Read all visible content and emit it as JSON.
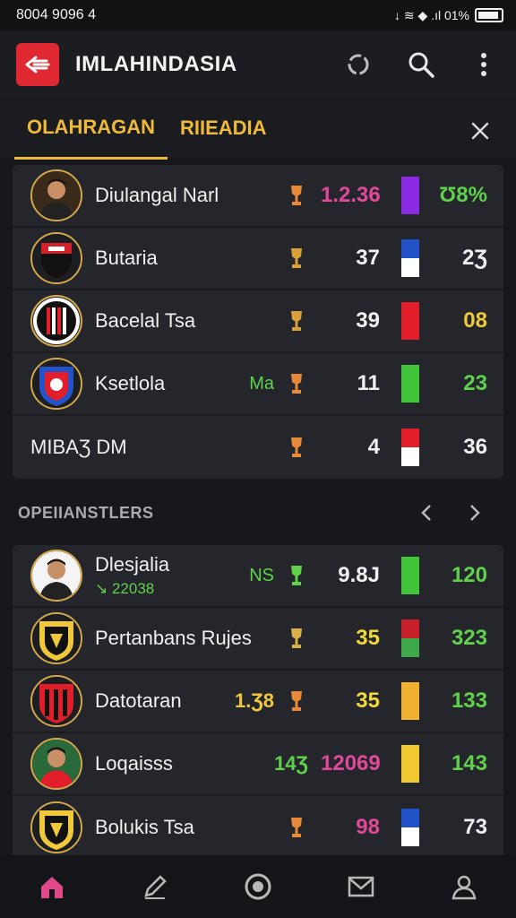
{
  "status": {
    "time": "8004 9096 4",
    "right": "↓ ≋ ◆ .ıl 01%"
  },
  "app": {
    "title": "IMLAHINDASIA"
  },
  "tabs": [
    {
      "label": "OLAHRAGAN"
    },
    {
      "label": "RIIEADIA"
    }
  ],
  "panel1": [
    {
      "name": "Diulangal Narl",
      "val1": "1.2.36",
      "val1_color": "#e0489a",
      "bar_top": "#8a2be2",
      "bar_bottom": "#8a2be2",
      "val2": "Ʊ8%",
      "val2_color": "#5fd14a",
      "crest": "player",
      "trophy_color": "#e8893a"
    },
    {
      "name": "Butaria",
      "val1": "37",
      "val1_color": "#f0f0f0",
      "bar_top": "#2352c8",
      "bar_bottom": "#ffffff",
      "val2": "2Ʒ",
      "val2_color": "#f0f0f0",
      "crest": "shield-red-black",
      "trophy_color": "#d9a03a"
    },
    {
      "name": "Bacelal Tsa",
      "val1": "39",
      "val1_color": "#f0f0f0",
      "bar_top": "#e21e2a",
      "bar_bottom": "#e21e2a",
      "val2": "08",
      "val2_color": "#f0c83a",
      "crest": "stripes-red-white",
      "trophy_color": "#d9a03a"
    },
    {
      "name": "Ksetlola",
      "tag": "Ma",
      "val1": "11",
      "val1_color": "#f0f0f0",
      "bar_top": "#3fc43a",
      "bar_bottom": "#3fc43a",
      "val2": "23",
      "val2_color": "#5fd14a",
      "crest": "shield-blue-red",
      "trophy_color": "#e8893a"
    },
    {
      "name": "MIBAƷ DM",
      "val1": "4",
      "val1_color": "#f0f0f0",
      "bar_top": "#e21e2a",
      "bar_bottom": "#ffffff",
      "val2": "36",
      "val2_color": "#f0f0f0",
      "crest": "none",
      "trophy_color": "#e8893a"
    }
  ],
  "section": {
    "title": "OPEIIANSTLERS"
  },
  "panel2": [
    {
      "name": "Dlesjalia",
      "sub": "↘ 22038",
      "tag": "NS",
      "val1": "9.8Ј",
      "val1_color": "#f0f0f0",
      "bar_top": "#3fc43a",
      "bar_bottom": "#3fc43a",
      "val2": "120",
      "val2_color": "#5fd14a",
      "crest": "player2",
      "trophy_color": "#5fd14a"
    },
    {
      "name": "Pertanbans Rujes",
      "val1": "35",
      "val1_color": "#f0d83a",
      "bar_top": "#c8202a",
      "bar_bottom": "#3fa84a",
      "val2": "323",
      "val2_color": "#5fd14a",
      "crest": "shield-yellow-black",
      "trophy_color": "#d9b04a"
    },
    {
      "name": "Datotaran",
      "pre": "1.Ʒ8",
      "pre_color": "#f0c83a",
      "val1": "35",
      "val1_color": "#f0d83a",
      "bar_top": "#f0b030",
      "bar_bottom": "#f0b030",
      "val2": "133",
      "val2_color": "#5fd14a",
      "crest": "shield-red-black2",
      "trophy_color": "#e8893a"
    },
    {
      "name": "Loqaisss",
      "pre": "14Ʒ",
      "pre_color": "#5fd14a",
      "val1": "12069",
      "val1_color": "#e0489a",
      "bar_top": "#f0c830",
      "bar_bottom": "#f0c830",
      "val2": "143",
      "val2_color": "#5fd14a",
      "crest": "player3",
      "trophy_color": "none"
    },
    {
      "name": "Bolukis Tsa",
      "val1": "98",
      "val1_color": "#e0489a",
      "bar_top": "#2352c8",
      "bar_bottom": "#ffffff",
      "val2": "73",
      "val2_color": "#f0f0f0",
      "crest": "shield-yellow-black2",
      "trophy_color": "#e8893a"
    }
  ],
  "bottom_nav": [
    {
      "icon": "home-icon",
      "color": "#e0488a"
    },
    {
      "icon": "edit-icon",
      "color": "#b8b8b8"
    },
    {
      "icon": "ball-icon",
      "color": "#b8b8b8"
    },
    {
      "icon": "mail-icon",
      "color": "#b8b8b8"
    },
    {
      "icon": "profile-icon",
      "color": "#b8b8b8"
    }
  ],
  "colors": {
    "accent": "#f0b93a",
    "brand": "#e02832",
    "background": "#17181b",
    "panel": "#24262b"
  }
}
